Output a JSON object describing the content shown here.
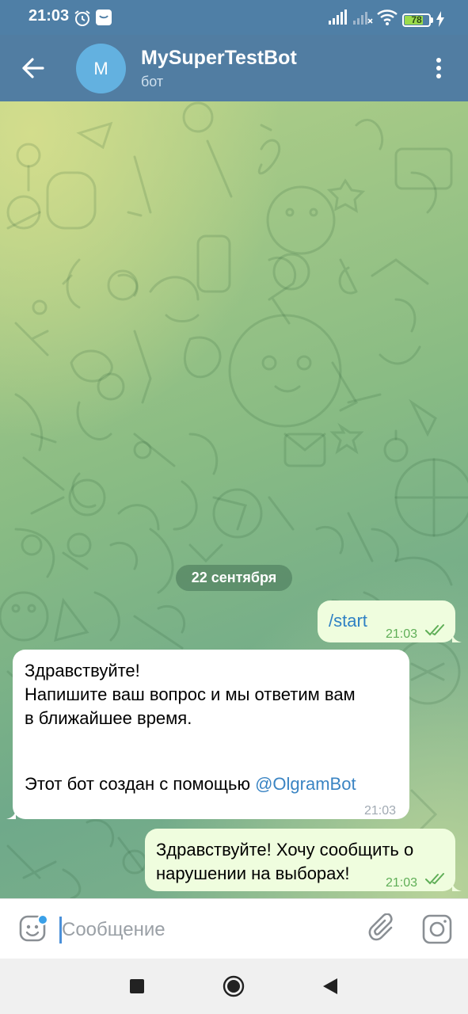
{
  "status_bar": {
    "time": "21:03",
    "battery": "78",
    "battery_level": 0.78,
    "icons": [
      "alarm-icon",
      "notification-icon",
      "signal-icon",
      "signal-off-icon",
      "wifi-icon",
      "battery-icon",
      "charging-icon"
    ]
  },
  "header": {
    "avatar_letter": "M",
    "title": "MySuperTestBot",
    "subtitle": "бот",
    "avatar_color": "#63b1e0",
    "header_color": "#517da2"
  },
  "chat": {
    "date": "22 сентября",
    "messages": [
      {
        "direction": "out",
        "text": "/start",
        "time": "21:03",
        "status": "read"
      },
      {
        "direction": "in",
        "lines": [
          "Здравствуйте!",
          "Напишите ваш вопрос и мы ответим вам",
          "в ближайшее время."
        ],
        "footer_text": "Этот бот создан с помощью ",
        "mention": "@OlgramBot",
        "time": "21:03"
      },
      {
        "direction": "out",
        "lines": [
          "Здравствуйте! Хочу сообщить о",
          "нарушении на выборах!"
        ],
        "time": "21:03",
        "status": "read"
      }
    ]
  },
  "input": {
    "placeholder": "Сообщение",
    "value": ""
  },
  "colors": {
    "outgoing_bubble": "#effdde",
    "incoming_bubble": "#ffffff",
    "link": "#3a84c3",
    "checkmarks": "#5fae57"
  }
}
